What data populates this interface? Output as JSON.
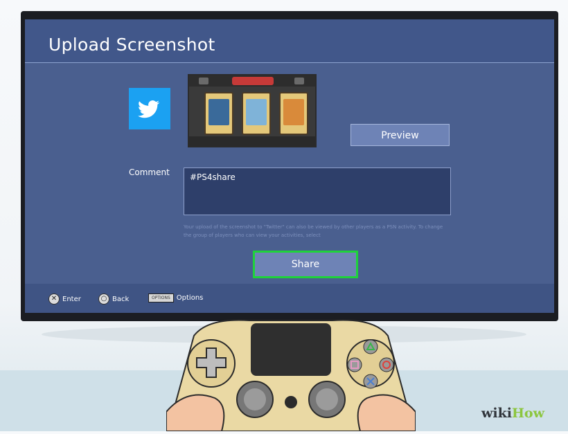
{
  "dialog": {
    "title": "Upload Screenshot",
    "share_target_icon": "twitter-bird-icon",
    "preview_label": "Preview",
    "comment_label": "Comment",
    "comment_value": "#PS4share",
    "notice": "Your upload of the screenshot to \"Twitter\" can also be viewed by other players as a PSN activity. To change the group of players who can view your activities, select",
    "share_label": "Share"
  },
  "footer": {
    "enter_key_icon": "cross-button-icon",
    "enter_label": "Enter",
    "back_key_icon": "circle-button-icon",
    "back_label": "Back",
    "options_key": "OPTIONS",
    "options_label": "Options"
  },
  "branding": {
    "wiki": "wiki",
    "how": "How"
  },
  "colors": {
    "screen_bg": "#4a5f8f",
    "twitter_blue": "#1ba1f2",
    "focus_green": "#1ed33a"
  }
}
